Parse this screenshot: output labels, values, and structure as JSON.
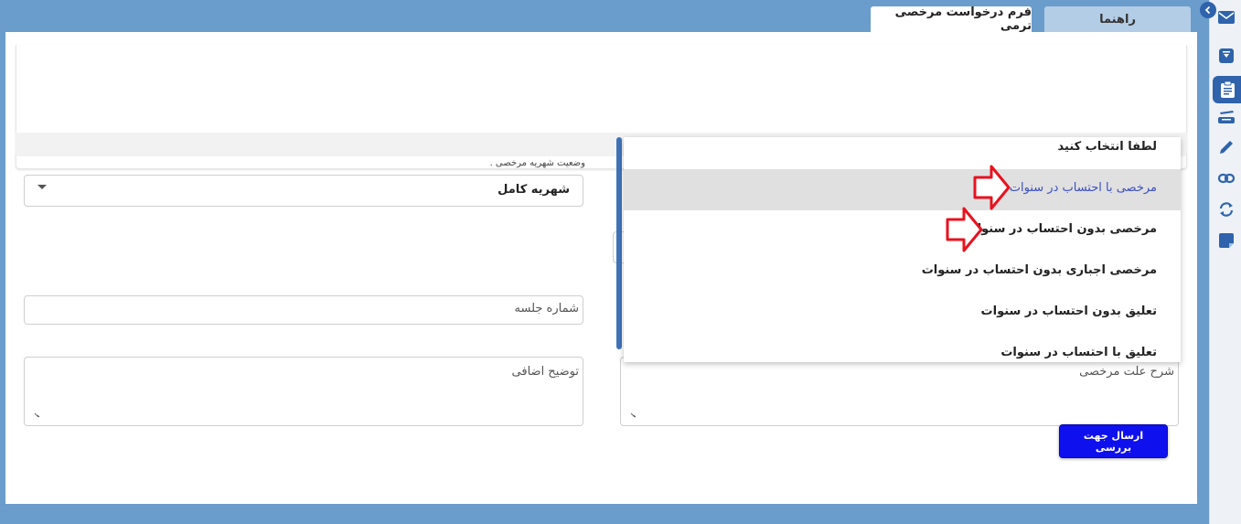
{
  "tabs": [
    {
      "label": "راهنما"
    },
    {
      "label": "فرم درخواست مرخصی ترمی"
    }
  ],
  "rail": {
    "icons": [
      "mail-icon",
      "archive-icon",
      "clipboard-icon",
      "inbox-tray-icon",
      "pencil-icon",
      "link-icon",
      "sync-icon",
      "note-icon"
    ],
    "active_index": 2,
    "collapse_icon": "chevron-left-icon"
  },
  "form": {
    "fee_status": {
      "label": "وضعیت شهریه مرخصی .",
      "value": "شهریه کامل"
    },
    "session_number": {
      "placeholder": "شماره جلسه"
    },
    "extra_description": {
      "placeholder": "توضیح اضافی"
    },
    "leave_reason": {
      "placeholder": "شرح علت مرخصی"
    },
    "submit_label": "ارسال جهت بررسی"
  },
  "leave_type_dropdown": {
    "options": [
      "لطفا انتخاب کنید",
      "مرخصی با احتساب در سنوات",
      "مرخصی بدون احتساب در سنوات",
      "مرخصی اجباری بدون احتساب در سنوات",
      "تعلیق بدون احتساب در سنوات",
      "تعلیق با احتساب در سنوات"
    ],
    "highlighted_index": 1
  },
  "colors": {
    "background": "#6a9ccc",
    "accent": "#2f63ab",
    "submit": "#0f10ee",
    "arrow": "#e8121e"
  }
}
